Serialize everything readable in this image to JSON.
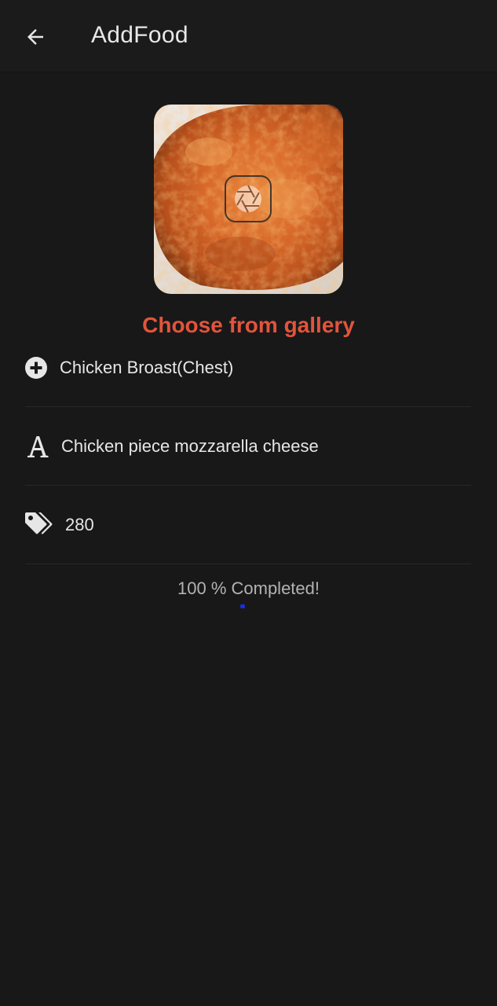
{
  "header": {
    "title": "AddFood"
  },
  "image": {
    "action_label": "Choose from gallery"
  },
  "form": {
    "name_value": "Chicken Broast(Chest)",
    "description_value": "Chicken piece mozzarella cheese",
    "price_value": "280"
  },
  "progress": {
    "text": "100 % Completed!",
    "fraction": 1.0
  },
  "colors": {
    "accent": "#e2543c",
    "background": "#181818",
    "progress": "#1a2de8"
  },
  "icons": {
    "back": "arrow-left-icon",
    "name": "plus-circle-icon",
    "description": "font-letter-a-icon",
    "price": "tags-icon",
    "camera": "camera-aperture-icon"
  }
}
